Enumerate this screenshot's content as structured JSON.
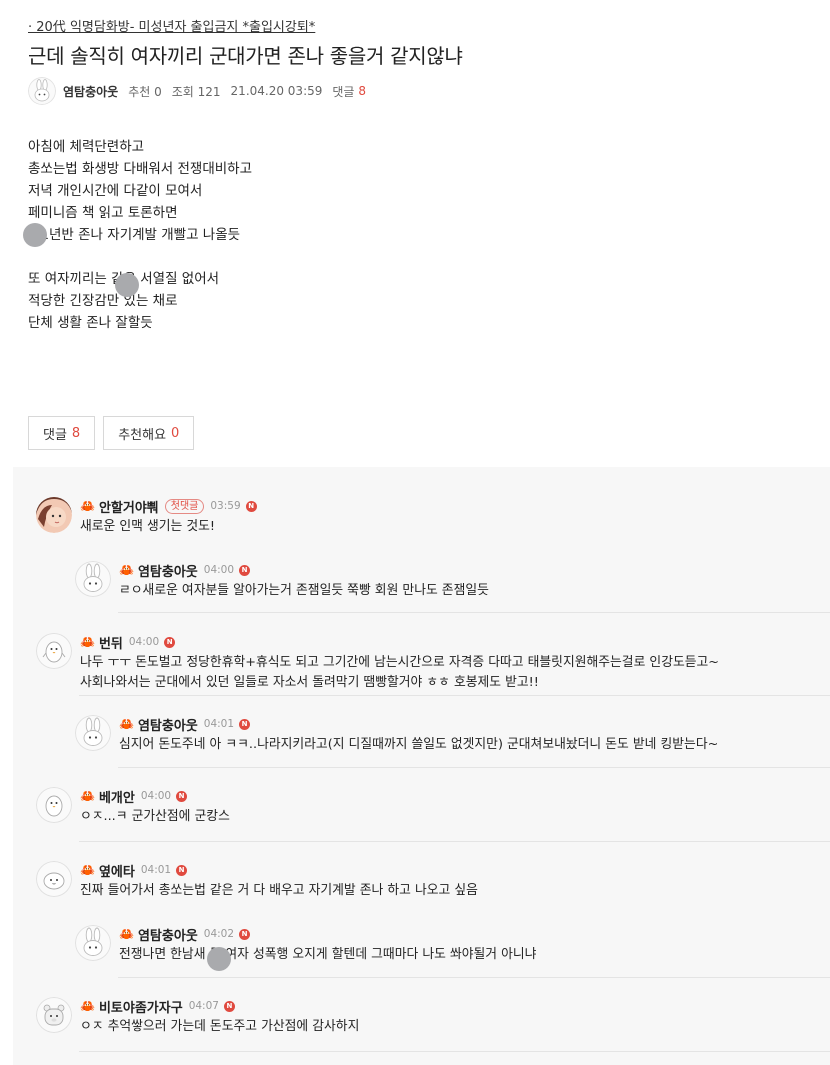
{
  "post": {
    "board": "· 20代 익명담화방- 미성년자 출입금지 *출입시강퇴*",
    "title": "근데 솔직히 여자끼리 군대가면 존나 좋을거 같지않냐",
    "author": "염탐충아웃",
    "recommend": "추천 0",
    "views": "조회 121",
    "datetime": "21.04.20 03:59",
    "reply_label": "댓글",
    "reply_count": "8",
    "body": [
      "아침에 체력단련하고",
      "총쏘는법 화생방 다배워서 전쟁대비하고",
      "저녁 개인시간에 다같이 모여서",
      "페미니즘 책 읽고 토론하면",
      "ㅋ1년반 존나 자기계발 개빨고 나올듯",
      "",
      "또 여자끼리는   같은 서열질 없어서",
      "적당한 긴장감만 있는 채로",
      "단체 생활 존나 잘할듯"
    ]
  },
  "buttons": {
    "reply_label": "댓글",
    "reply_count": "8",
    "recommend_label": "추천해요",
    "recommend_count": "0"
  },
  "comments": [
    {
      "nick": "안할거야뿨",
      "badge": "첫댓글",
      "time": "03:59",
      "new": "N",
      "text": "새로운 인맥 생기는 것도!",
      "avatar": "photo-avatar"
    },
    {
      "nick": "염탐충아웃",
      "time": "04:00",
      "new": "N",
      "text": "ㄹㅇ새로운 여자분들 알아가는거 존잼일듯 쭉빵 회원 만나도 존잼일듯",
      "avatar": "rabbit-avatar"
    },
    {
      "nick": "번뒤",
      "time": "04:00",
      "new": "N",
      "text": "나두 ㅜㅜ 돈도벌고 정당한휴학+휴식도 되고 그기간에 남는시간으로 자격증 다따고 태블릿지원해주는걸로 인강도듣고~",
      "text2": "사회나와서는 군대에서 있던 일들로 자소서 돌려막기 땜빵할거야 ㅎㅎ 호봉제도 받고!!",
      "avatar": "penguin-avatar"
    },
    {
      "nick": "염탐충아웃",
      "time": "04:01",
      "new": "N",
      "text": "심지어 돈도주네 아 ㅋㅋ..나라지키라고(지 디질때까지 쓸일도 없겟지만) 군대쳐보내놨더니 돈도 받네 킹받는다~",
      "avatar": "rabbit-avatar"
    },
    {
      "nick": "베개안",
      "time": "04:00",
      "new": "N",
      "text": "ㅇㅈ...ㅋ 군가산점에 군캉스",
      "avatar": "penguin-avatar"
    },
    {
      "nick": "옆에타",
      "time": "04:01",
      "new": "N",
      "text": "진짜 들어가서 총쏘는법 같은 거 다 배우고 자기계발 존나 하고 나오고 싶음",
      "avatar": "blob-avatar"
    },
    {
      "nick": "염탐충아웃",
      "time": "04:02",
      "new": "N",
      "text": "전쟁나면 한남새   들 여자 성폭행 오지게 할텐데 그때마다 나도 쏴야될거 아니냐",
      "avatar": "rabbit-avatar"
    },
    {
      "nick": "비토야좀가자구",
      "time": "04:07",
      "new": "N",
      "text": "ㅇㅈ 추억쌓으러 가는데 돈도주고 가산점에 감사하지",
      "avatar": "bear-avatar"
    }
  ],
  "colors": {
    "accent": "#e04a3f",
    "comment_bg": "#f7f7f7"
  }
}
